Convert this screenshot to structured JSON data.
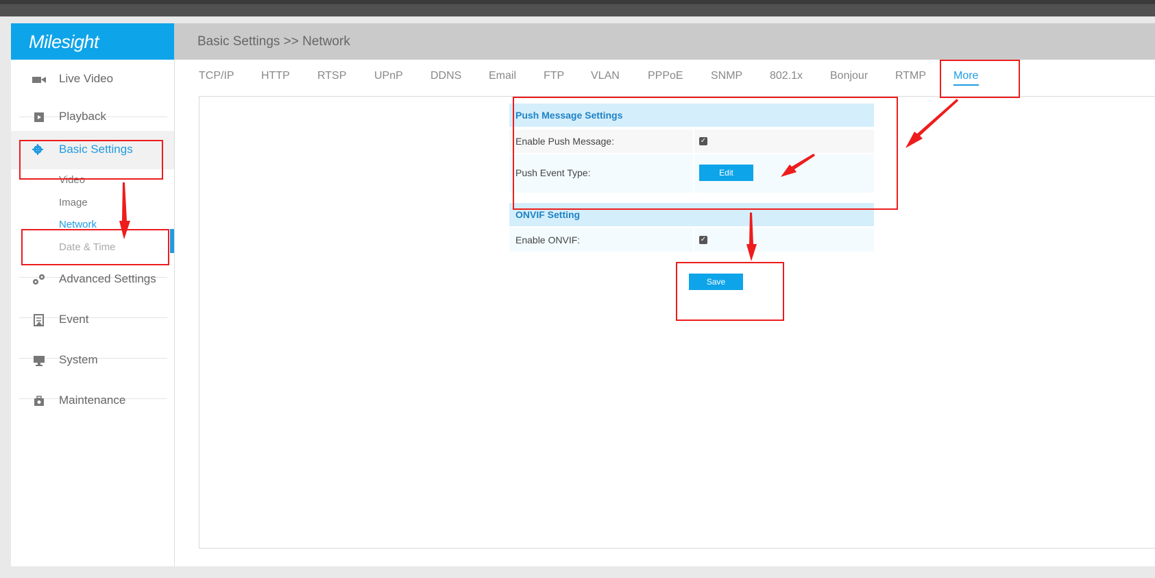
{
  "app": {
    "logo": "Milesight"
  },
  "header": {
    "breadcrumb": "Basic Settings >> Network"
  },
  "sidebar": {
    "items": [
      {
        "label": "Live Video",
        "icon": "video-camera-icon"
      },
      {
        "label": "Playback",
        "icon": "play-icon"
      },
      {
        "label": "Basic Settings",
        "icon": "gear-icon"
      },
      {
        "label": "Advanced Settings",
        "icon": "gears-icon"
      },
      {
        "label": "Event",
        "icon": "event-icon"
      },
      {
        "label": "System",
        "icon": "monitor-icon"
      },
      {
        "label": "Maintenance",
        "icon": "toolbox-icon"
      }
    ],
    "sub_items": [
      "Video",
      "Image",
      "Network",
      "Date & Time"
    ]
  },
  "tabs": [
    "TCP/IP",
    "HTTP",
    "RTSP",
    "UPnP",
    "DDNS",
    "Email",
    "FTP",
    "VLAN",
    "PPPoE",
    "SNMP",
    "802.1x",
    "Bonjour",
    "RTMP",
    "More"
  ],
  "push_section": {
    "title": "Push Message Settings",
    "enable_label": "Enable Push Message:",
    "enable_checked": true,
    "event_label": "Push Event Type:",
    "edit_label": "Edit"
  },
  "onvif_section": {
    "title": "ONVIF Setting",
    "enable_label": "Enable ONVIF:",
    "enable_checked": true
  },
  "save_label": "Save",
  "colors": {
    "accent": "#1f9be0",
    "logo_bg": "#0ea4e9",
    "annotation": "#ee1c1c"
  }
}
